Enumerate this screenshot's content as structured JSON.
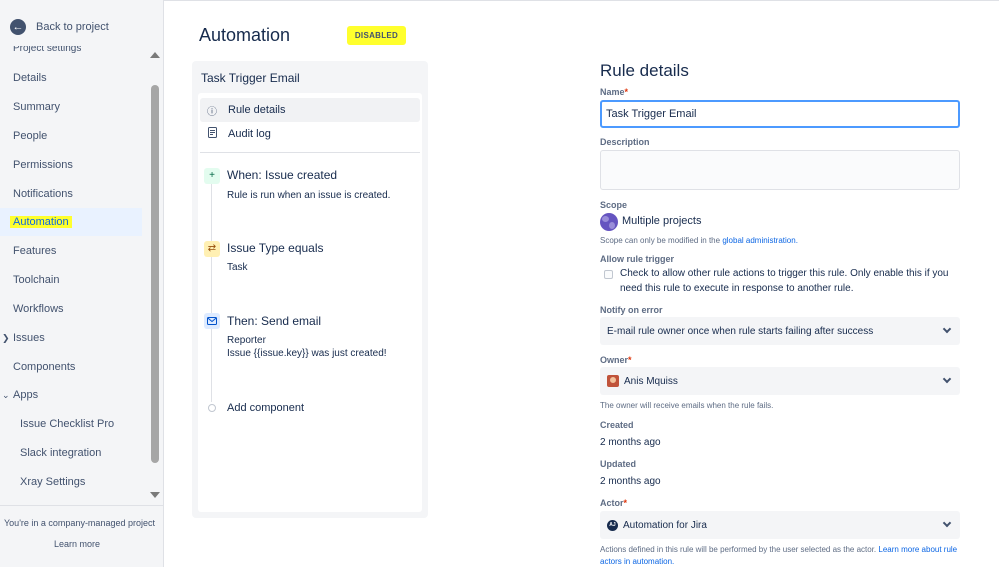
{
  "sidebar": {
    "back_label": "Back to project",
    "section_title": "Project settings",
    "items": [
      {
        "label": "Details"
      },
      {
        "label": "Summary"
      },
      {
        "label": "People"
      },
      {
        "label": "Permissions"
      },
      {
        "label": "Notifications"
      },
      {
        "label": "Automation"
      },
      {
        "label": "Features"
      },
      {
        "label": "Toolchain"
      },
      {
        "label": "Workflows"
      },
      {
        "label": "Issues"
      },
      {
        "label": "Components"
      },
      {
        "label": "Apps"
      },
      {
        "label": "Issue Checklist Pro"
      },
      {
        "label": "Slack integration"
      },
      {
        "label": "Xray Settings"
      }
    ],
    "footer_text": "You're in a company-managed project",
    "learn_more": "Learn more"
  },
  "header": {
    "title": "Automation",
    "status_badge": "DISABLED"
  },
  "rule_panel": {
    "title": "Task Trigger Email",
    "menu": [
      {
        "label": "Rule details"
      },
      {
        "label": "Audit log"
      }
    ],
    "components": [
      {
        "title": "When: Issue created",
        "desc": "Rule is run when an issue is created."
      },
      {
        "title": "Issue Type equals",
        "desc": "Task"
      },
      {
        "title": "Then: Send email",
        "desc": "Reporter",
        "desc2": "Issue {{issue.key}} was just created!"
      }
    ],
    "add_component": "Add component"
  },
  "form": {
    "title": "Rule details",
    "name_label": "Name",
    "name_value": "Task Trigger Email",
    "description_label": "Description",
    "description_value": "",
    "scope_label": "Scope",
    "scope_value": "Multiple projects",
    "scope_help": "Scope can only be modified in the",
    "scope_help_link": "global administration.",
    "allow_trigger_label": "Allow rule trigger",
    "allow_trigger_text": "Check to allow other rule actions to trigger this rule. Only enable this if you need this rule to execute in response to another rule.",
    "allow_trigger_checked": false,
    "notify_label": "Notify on error",
    "notify_value": "E-mail rule owner once when rule starts failing after success",
    "owner_label": "Owner",
    "owner_value": "Anis Mquiss",
    "owner_help": "The owner will receive emails when the rule fails.",
    "created_label": "Created",
    "created_value": "2 months ago",
    "updated_label": "Updated",
    "updated_value": "2 months ago",
    "actor_label": "Actor",
    "actor_value": "Automation for Jira",
    "actor_avatar_text": "AJ",
    "actor_help": "Actions defined in this rule will be performed by the user selected as the actor.",
    "actor_help_link1": "Learn more",
    "actor_help_link2": "about rule actors in automation.",
    "required_mark": "*"
  },
  "colors": {
    "highlight": "#ffff2d",
    "link": "#0c66e4",
    "selected_bg": "#e9f2ff",
    "focus_border": "#4c9aff",
    "required": "#de350b"
  },
  "icons": {
    "back": "arrow-left-icon",
    "rule_details": "info-icon",
    "audit_log": "document-icon",
    "trigger": "plus-icon",
    "condition": "shuffle-icon",
    "action": "mail-icon",
    "scope": "globe-icon",
    "dropdown": "chevron-down-icon"
  }
}
